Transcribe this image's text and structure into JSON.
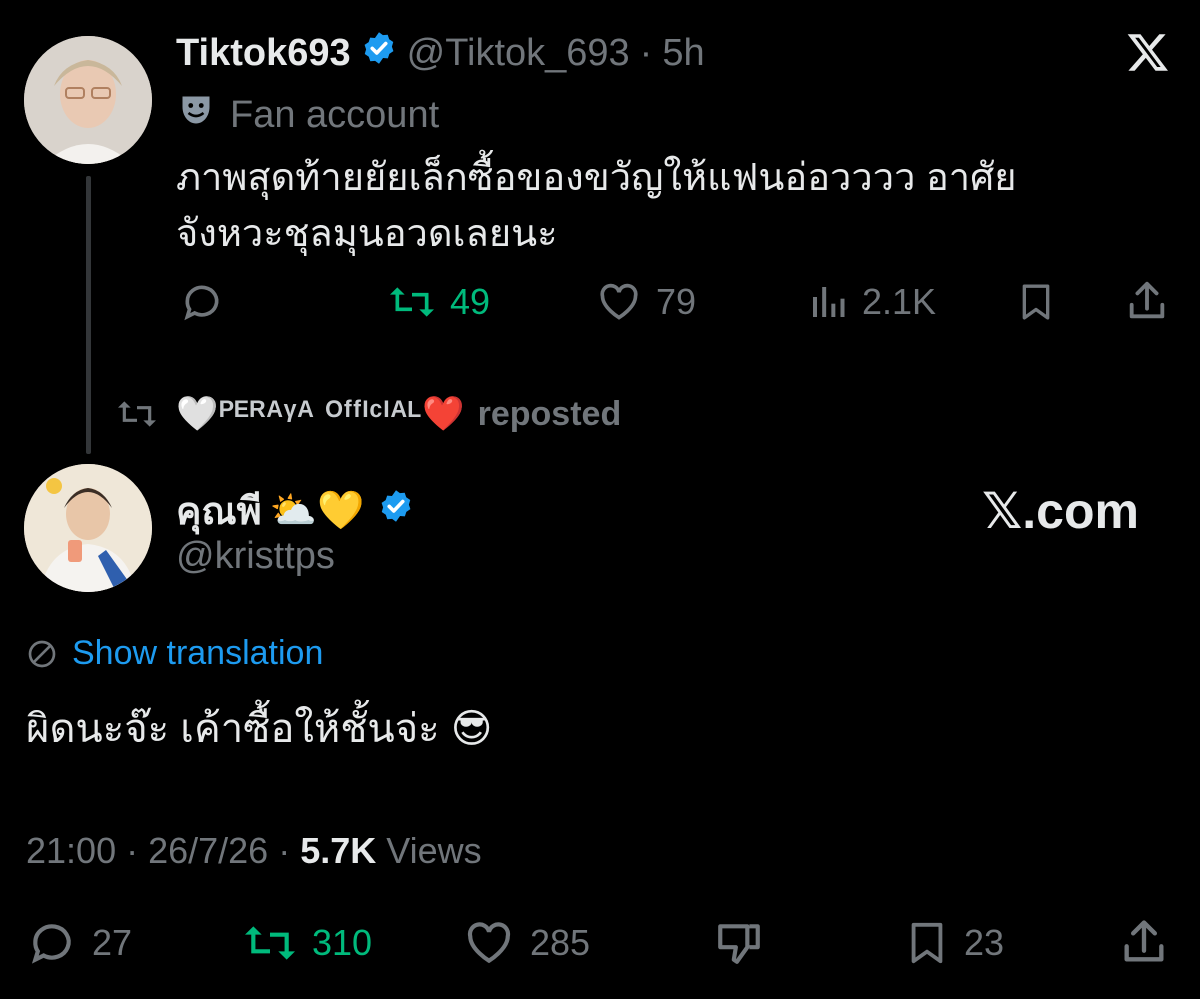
{
  "quoted_tweet": {
    "display_name": "Tiktok693",
    "handle": "@Tiktok_693",
    "separator": "·",
    "time": "5h",
    "label": "Fan account",
    "text_line1": "ภาพสุดท้ายยัยเล็กซื้อของขวัญให้แฟนอ่อวววว อาศัย",
    "text_line2": "จังหวะชุลมุนอวดเลยนะ",
    "stats": {
      "retweets": "49",
      "likes": "79",
      "views": "2.1K"
    }
  },
  "repost_banner": {
    "reposter": "🤍ᴾᴱᴿᴬᵞᴬ ᴼᶠᶠᴵᶜᴵᴬᴸ❤️",
    "action": "reposted"
  },
  "main_tweet": {
    "display_name": "คุณพี",
    "name_emoji": "⛅💛",
    "handle": "@kristtps",
    "watermark": "𝕏.com",
    "translate_label": "Show translation",
    "text": "ผิดนะจ๊ะ เค้าซื้อให้ชั้นจ่ะ 😎",
    "time": "21:00",
    "date": "26/7/26",
    "dot": "·",
    "views_count": "5.7K",
    "views_label": "Views",
    "stats": {
      "replies": "27",
      "retweets": "310",
      "likes": "285",
      "bookmarks": "23"
    }
  },
  "colors": {
    "background": "#000000",
    "accent": "#1d9bf0",
    "retweet": "#00ba7c",
    "muted": "#71767b",
    "text": "#e7e9ea"
  }
}
